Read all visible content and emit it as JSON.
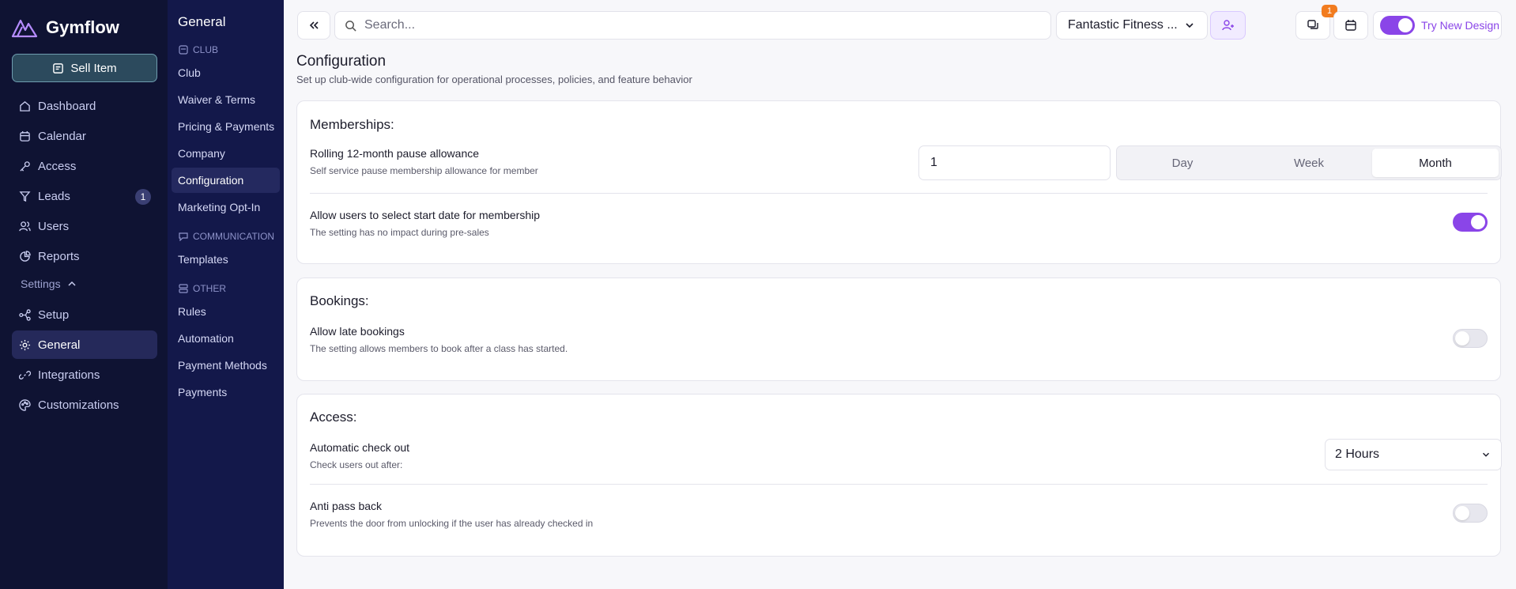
{
  "brand": {
    "name": "Gymflow"
  },
  "sell_button": {
    "label": "Sell Item"
  },
  "nav": {
    "items": [
      {
        "label": "Dashboard",
        "icon": "home-icon"
      },
      {
        "label": "Calendar",
        "icon": "calendar-icon"
      },
      {
        "label": "Access",
        "icon": "key-icon"
      },
      {
        "label": "Leads",
        "icon": "filter-icon",
        "badge": "1"
      },
      {
        "label": "Users",
        "icon": "users-icon"
      },
      {
        "label": "Reports",
        "icon": "pie-chart-icon"
      }
    ],
    "settings_label": "Settings",
    "settings_items": [
      {
        "label": "Setup",
        "icon": "setup-icon"
      },
      {
        "label": "General",
        "icon": "gear-icon"
      },
      {
        "label": "Integrations",
        "icon": "link-icon"
      },
      {
        "label": "Customizations",
        "icon": "palette-icon"
      }
    ]
  },
  "subnav": {
    "title": "General",
    "sections": [
      {
        "label": "CLUB",
        "items": [
          "Club",
          "Waiver & Terms",
          "Pricing & Payments",
          "Company",
          "Configuration",
          "Marketing Opt-In"
        ]
      },
      {
        "label": "COMMUNICATION",
        "items": [
          "Templates"
        ]
      },
      {
        "label": "OTHER",
        "items": [
          "Rules",
          "Automation",
          "Payment Methods",
          "Payments"
        ]
      }
    ],
    "active": "Configuration"
  },
  "topbar": {
    "search_placeholder": "Search...",
    "club_name": "Fantastic Fitness ...",
    "messages_badge": "1",
    "try_new_design": "Try New Design"
  },
  "page": {
    "title": "Configuration",
    "subtitle": "Set up club-wide configuration for operational processes, policies, and feature behavior"
  },
  "memberships": {
    "title": "Memberships:",
    "pause": {
      "title": "Rolling 12-month pause allowance",
      "desc": "Self service pause membership allowance for member",
      "value": "1",
      "periods": [
        "Day",
        "Week",
        "Month"
      ],
      "selected_period": "Month"
    },
    "start_date": {
      "title": "Allow users to select start date for membership",
      "desc": "The setting has no impact during pre-sales",
      "enabled": true
    }
  },
  "bookings": {
    "title": "Bookings:",
    "late": {
      "title": "Allow late bookings",
      "desc": "The setting allows members to book after a class has started.",
      "enabled": false
    }
  },
  "access": {
    "title": "Access:",
    "checkout": {
      "title": "Automatic check out",
      "desc": "Check users out after:",
      "value": "2 Hours"
    },
    "anti_pass_back": {
      "title": "Anti pass back",
      "desc": "Prevents the door from unlocking if the user has already checked in",
      "enabled": false
    }
  },
  "colors": {
    "accent": "#8a45e8",
    "sidebar": "#0f1333",
    "subnav": "#13184a",
    "badge": "#f27c1f"
  }
}
